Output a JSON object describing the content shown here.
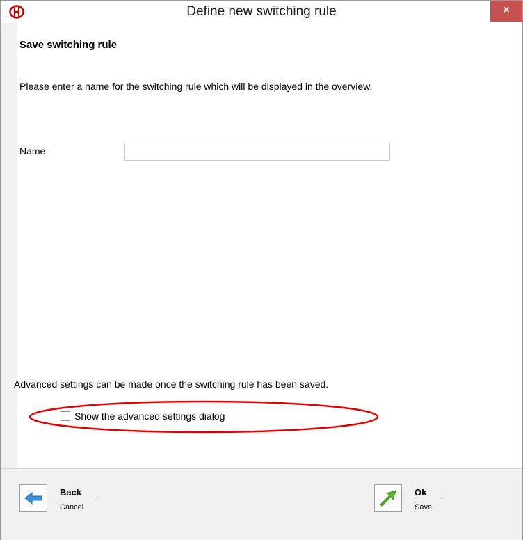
{
  "window": {
    "title": "Define new switching rule",
    "close_glyph": "×"
  },
  "main": {
    "section_title": "Save switching rule",
    "description": "Please enter a name for the switching rule which will be displayed in the overview.",
    "name_label": "Name",
    "name_value": "",
    "advanced_note": "Advanced settings can be made once the switching rule has been saved.",
    "advanced_checkbox_label": "Show the advanced settings dialog",
    "advanced_checkbox_checked": false
  },
  "footer": {
    "back_label": "Back",
    "back_sub": "Cancel",
    "ok_label": "Ok",
    "ok_sub": "Save"
  },
  "colors": {
    "close_button": "#c75050",
    "highlight": "#e00000",
    "back_arrow": "#3a8fd6",
    "ok_arrow": "#5cb82e"
  }
}
